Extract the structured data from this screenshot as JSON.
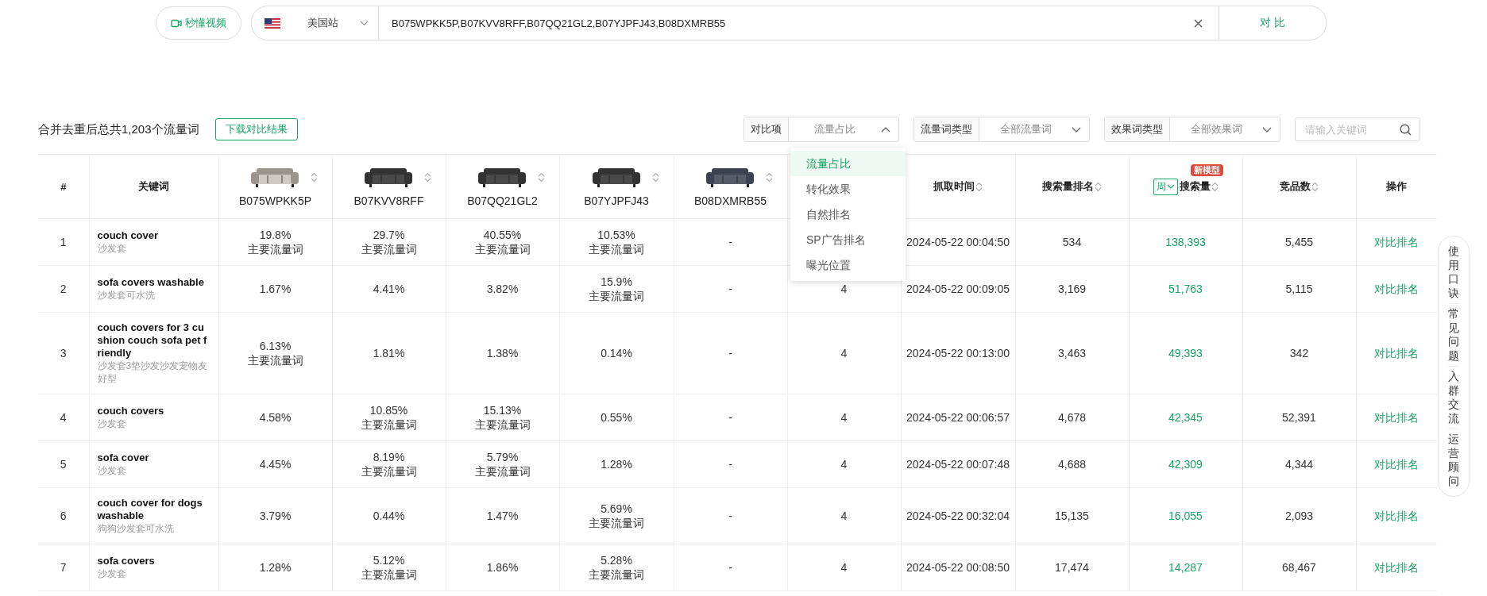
{
  "top_bar": {
    "video_button": "秒懂视频",
    "site": "美国站",
    "asin_input": {
      "value": "B075WPKK5P,B07KVV8RFF,B07QQ21GL2,B07YJPFJ43,B08DXMRB55"
    },
    "compare_button": "对 比"
  },
  "summary": "合并去重后总共1,203个流量词",
  "download_button": "下载对比结果",
  "filters": [
    {
      "label": "对比项",
      "value": "流量占比",
      "open": true
    },
    {
      "label": "流量词类型",
      "value": "全部流量词",
      "open": false
    },
    {
      "label": "效果词类型",
      "value": "全部效果词",
      "open": false
    }
  ],
  "search": {
    "placeholder": "请输入关键词"
  },
  "dropdown": {
    "options": [
      {
        "label": "流量占比",
        "selected": true
      },
      {
        "label": "转化效果",
        "selected": false
      },
      {
        "label": "自然排名",
        "selected": false
      },
      {
        "label": "SP广告排名",
        "selected": false
      },
      {
        "label": "曝光位置",
        "selected": false
      }
    ]
  },
  "table": {
    "columns": [
      {
        "kind": "plain",
        "label": "#"
      },
      {
        "kind": "plain",
        "label": "关键词"
      },
      {
        "kind": "product",
        "label": "B075WPKK5P"
      },
      {
        "kind": "product",
        "label": "B07KVV8RFF"
      },
      {
        "kind": "product",
        "label": "B07QQ21GL2"
      },
      {
        "kind": "product",
        "label": "B07YJPFJ43"
      },
      {
        "kind": "product",
        "label": "B08DXMRB55"
      },
      {
        "kind": "covered"
      },
      {
        "kind": "sort",
        "label": "抓取时间"
      },
      {
        "kind": "sort",
        "label": "搜索量排名"
      },
      {
        "kind": "volume",
        "label": "搜索量",
        "period": "周",
        "badge": "新模型"
      },
      {
        "kind": "sort",
        "label": "竞品数"
      },
      {
        "kind": "plain",
        "label": "操作"
      }
    ],
    "rows": [
      {
        "index": "1",
        "keyword": "couch cover",
        "translation": "沙发套",
        "shares": [
          {
            "value": "19.8%",
            "tag": "主要流量词"
          },
          {
            "value": "29.7%",
            "tag": "主要流量词"
          },
          {
            "value": "40.55%",
            "tag": "主要流量词"
          },
          {
            "value": "10.53%",
            "tag": "主要流量词"
          },
          {
            "value": "-"
          }
        ],
        "time": "2024-05-22 00:04:50",
        "rank": "534",
        "volume": "138,393",
        "competitors": "5,455",
        "action": "对比排名"
      },
      {
        "index": "2",
        "keyword": "sofa covers washable",
        "translation": "沙发套可水洗",
        "shares": [
          {
            "value": "1.67%"
          },
          {
            "value": "4.41%"
          },
          {
            "value": "3.82%"
          },
          {
            "value": "15.9%",
            "tag": "主要流量词"
          },
          {
            "value": "-"
          }
        ],
        "column_7": "4",
        "time": "2024-05-22 00:09:05",
        "rank": "3,169",
        "volume": "51,763",
        "competitors": "5,115",
        "action": "对比排名"
      },
      {
        "index": "3",
        "keyword": "couch covers for 3 cushion couch sofa pet friendly",
        "translation": "沙发套3垫沙发沙发宠物友好型",
        "shares": [
          {
            "value": "6.13%",
            "tag": "主要流量词"
          },
          {
            "value": "1.81%"
          },
          {
            "value": "1.38%"
          },
          {
            "value": "0.14%"
          },
          {
            "value": "-"
          }
        ],
        "column_7": "4",
        "time": "2024-05-22 00:13:00",
        "rank": "3,463",
        "volume": "49,393",
        "competitors": "342",
        "action": "对比排名"
      },
      {
        "index": "4",
        "keyword": "couch covers",
        "translation": "沙发套",
        "shares": [
          {
            "value": "4.58%"
          },
          {
            "value": "10.85%",
            "tag": "主要流量词"
          },
          {
            "value": "15.13%",
            "tag": "主要流量词"
          },
          {
            "value": "0.55%"
          },
          {
            "value": "-"
          }
        ],
        "column_7": "4",
        "time": "2024-05-22 00:06:57",
        "rank": "4,678",
        "volume": "42,345",
        "competitors": "52,391",
        "action": "对比排名"
      },
      {
        "index": "5",
        "keyword": "sofa cover",
        "translation": "沙发套",
        "shares": [
          {
            "value": "4.45%"
          },
          {
            "value": "8.19%",
            "tag": "主要流量词"
          },
          {
            "value": "5.79%",
            "tag": "主要流量词"
          },
          {
            "value": "1.28%"
          },
          {
            "value": "-"
          }
        ],
        "column_7": "4",
        "time": "2024-05-22 00:07:48",
        "rank": "4,688",
        "volume": "42,309",
        "competitors": "4,344",
        "action": "对比排名"
      },
      {
        "index": "6",
        "keyword": "couch cover for dogs washable",
        "translation": "狗狗沙发套可水洗",
        "shares": [
          {
            "value": "3.79%"
          },
          {
            "value": "0.44%"
          },
          {
            "value": "1.47%"
          },
          {
            "value": "5.69%",
            "tag": "主要流量词"
          },
          {
            "value": "-"
          }
        ],
        "column_7": "4",
        "time": "2024-05-22 00:32:04",
        "rank": "15,135",
        "volume": "16,055",
        "competitors": "2,093",
        "action": "对比排名"
      },
      {
        "index": "7",
        "keyword": "sofa covers",
        "translation": "沙发套",
        "shares": [
          {
            "value": "1.28%"
          },
          {
            "value": "5.12%",
            "tag": "主要流量词"
          },
          {
            "value": "1.86%"
          },
          {
            "value": "5.28%",
            "tag": "主要流量词"
          },
          {
            "value": "-"
          }
        ],
        "column_7": "4",
        "time": "2024-05-22 00:08:50",
        "rank": "17,474",
        "volume": "14,287",
        "competitors": "68,467",
        "action": "对比排名"
      }
    ]
  },
  "side_menu": [
    "使用口诀",
    "常见问题",
    "入群交流",
    "运营顾问"
  ]
}
